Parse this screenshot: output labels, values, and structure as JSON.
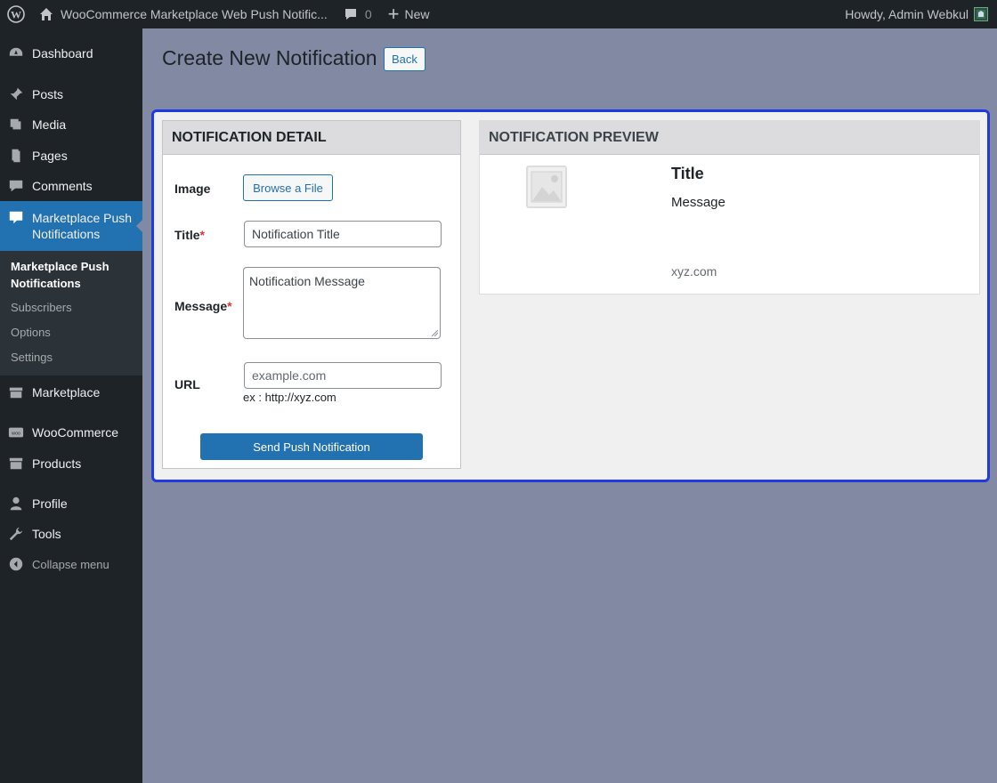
{
  "adminbar": {
    "site_name": "WooCommerce Marketplace Web Push Notific...",
    "comments_count": "0",
    "new_label": "New",
    "howdy": "Howdy, Admin Webkul"
  },
  "sidebar": {
    "items": [
      {
        "label": "Dashboard",
        "icon": "dashboard-icon"
      },
      {
        "label": "Posts",
        "icon": "pin-icon"
      },
      {
        "label": "Media",
        "icon": "media-icon"
      },
      {
        "label": "Pages",
        "icon": "pages-icon"
      },
      {
        "label": "Comments",
        "icon": "comments-icon"
      },
      {
        "label": "Marketplace Push Notifications",
        "icon": "megaphone-icon"
      },
      {
        "label": "Marketplace",
        "icon": "store-icon"
      },
      {
        "label": "WooCommerce",
        "icon": "woo-icon"
      },
      {
        "label": "Products",
        "icon": "archive-icon"
      },
      {
        "label": "Profile",
        "icon": "user-icon"
      },
      {
        "label": "Tools",
        "icon": "wrench-icon"
      }
    ],
    "submenu": [
      "Marketplace Push Notifications",
      "Subscribers",
      "Options",
      "Settings"
    ],
    "collapse_label": "Collapse menu"
  },
  "page": {
    "title": "Create New Notification",
    "back_label": "Back"
  },
  "detail": {
    "heading": "NOTIFICATION DETAIL",
    "image_label": "Image",
    "browse_label": "Browse a File",
    "title_label": "Title",
    "title_placeholder": "Notification Title",
    "message_label": "Message",
    "message_placeholder": "Notification Message",
    "url_label": "URL",
    "url_placeholder": "example.com",
    "url_hint": "ex : http://xyz.com",
    "required_mark": "*",
    "send_label": "Send Push Notification"
  },
  "preview": {
    "heading": "NOTIFICATION PREVIEW",
    "title": "Title",
    "message": "Message",
    "url": "xyz.com"
  },
  "colors": {
    "accent": "#2271b1",
    "frame_highlight": "#1e3ae0",
    "required": "#d63638"
  }
}
